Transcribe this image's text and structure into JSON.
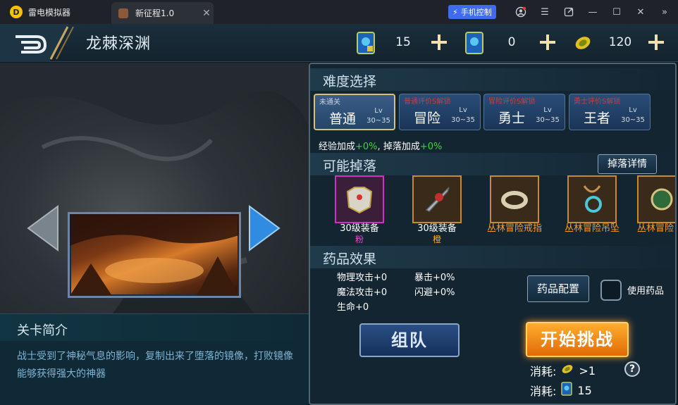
{
  "window": {
    "app_name": "雷电模拟器",
    "tab_label": "新征程1.0",
    "phone_control": "手机控制",
    "colors": {
      "titlebar": "#1f2329",
      "accent": "#3e6bf0"
    }
  },
  "header": {
    "stage_title": "龙棘深渊",
    "resources": [
      {
        "icon": "ticket-card-icon",
        "value": "15"
      },
      {
        "icon": "ticket-card-icon",
        "value": "0"
      },
      {
        "icon": "gold-coin-icon",
        "value": "120"
      }
    ]
  },
  "intro": {
    "title": "关卡简介",
    "text": "战士受到了神秘气息的影响，复制出来了堕落的镜像，打败镜像能够获得强大的神器"
  },
  "difficulty": {
    "title": "难度选择",
    "options": [
      {
        "tag": "未通关",
        "name": "普通",
        "lv_label": "Lv",
        "lv_range": "30~35",
        "selected": true
      },
      {
        "tag": "普通评价S解锁",
        "name": "冒险",
        "lv_label": "Lv",
        "lv_range": "30~35",
        "selected": false
      },
      {
        "tag": "冒险评价S解锁",
        "name": "勇士",
        "lv_label": "Lv",
        "lv_range": "30~35",
        "selected": false
      },
      {
        "tag": "勇士评价S解锁",
        "name": "王者",
        "lv_label": "Lv",
        "lv_range": "30~35",
        "selected": false
      }
    ]
  },
  "bonus": {
    "exp_label": "经验加成",
    "exp_value": "+0%",
    "sep": ",",
    "drop_label": "掉落加成",
    "drop_value": "+0%"
  },
  "drops": {
    "title": "可能掉落",
    "details_button": "掉落详情",
    "items": [
      {
        "name": "30级装备",
        "sub": "粉",
        "sub_color": "#e84ad6",
        "rarity": "pink",
        "icon": "armor-chest-icon"
      },
      {
        "name": "30级装备",
        "sub": "橙",
        "sub_color": "#ffb020",
        "rarity": "orange",
        "icon": "sword-icon"
      },
      {
        "name": "丛林冒险戒指",
        "sub": "",
        "sub_color": "",
        "rarity": "orange",
        "icon": "ring-icon"
      },
      {
        "name": "丛林冒险吊坠",
        "sub": "",
        "sub_color": "",
        "rarity": "orange",
        "icon": "pendant-icon"
      },
      {
        "name": "丛林冒险",
        "sub": "",
        "sub_color": "",
        "rarity": "orange",
        "icon": "item-icon"
      }
    ]
  },
  "potion": {
    "title": "药品效果",
    "stats": [
      {
        "label": "物理攻击",
        "value": "+0"
      },
      {
        "label": "暴击",
        "value": "+0%"
      },
      {
        "label": "魔法攻击",
        "value": "+0"
      },
      {
        "label": "闪避",
        "value": "+0%"
      },
      {
        "label": "生命",
        "value": "+0"
      }
    ],
    "config_button": "药品配置",
    "use_label": "使用药品",
    "use_checked": false
  },
  "actions": {
    "team_button": "组队",
    "start_button": "开始挑战",
    "costs": [
      {
        "label": "消耗:",
        "icon": "gold-coin-icon",
        "value": ">1"
      },
      {
        "label": "消耗:",
        "icon": "ticket-card-icon",
        "value": "15"
      }
    ],
    "help": "?"
  }
}
